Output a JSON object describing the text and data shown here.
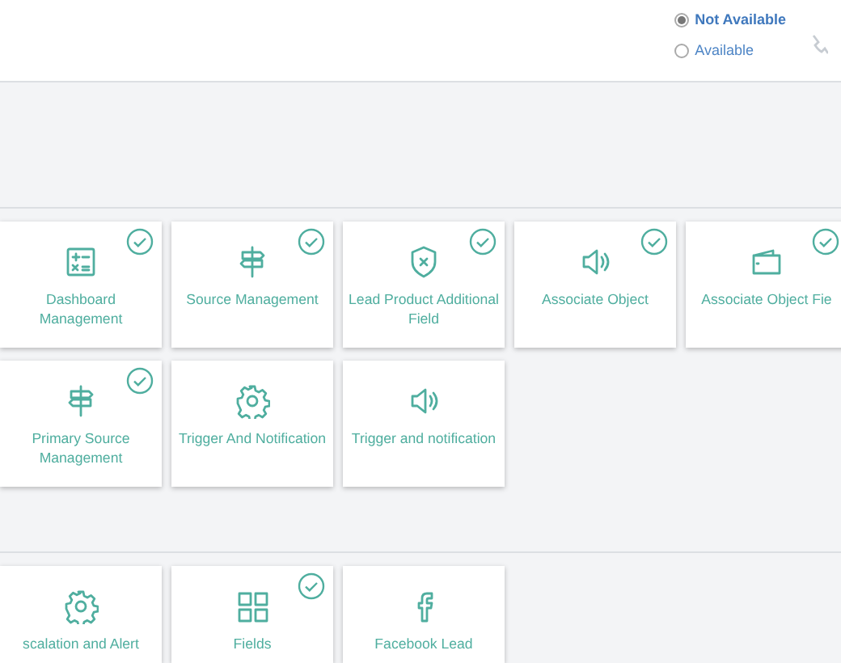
{
  "availability": [
    {
      "label": "Not Available",
      "selected": true
    },
    {
      "label": "Available",
      "selected": false
    }
  ],
  "sections": [
    {
      "cards": [
        {
          "label": "Dashboard Management",
          "kind": "calculator",
          "checked": true
        },
        {
          "label": "Source Management",
          "kind": "signpost",
          "checked": true
        },
        {
          "label": "Lead Product Additional Field",
          "kind": "shield",
          "checked": true
        },
        {
          "label": "Associate Object",
          "kind": "speaker",
          "checked": true
        },
        {
          "label": "Associate Object Fie",
          "kind": "wallet",
          "checked": true
        },
        {
          "label": "Primary Source Management",
          "kind": "signpost",
          "checked": true
        },
        {
          "label": "Trigger And Notification",
          "kind": "gear",
          "checked": false
        },
        {
          "label": "Trigger and notification",
          "kind": "speaker",
          "checked": false
        }
      ]
    },
    {
      "cards": [
        {
          "label": "scalation and Alert",
          "kind": "gear",
          "checked": false
        },
        {
          "label": "Fields",
          "kind": "grid",
          "checked": true
        },
        {
          "label": "Facebook Lead",
          "kind": "facebook",
          "checked": false
        }
      ]
    }
  ]
}
